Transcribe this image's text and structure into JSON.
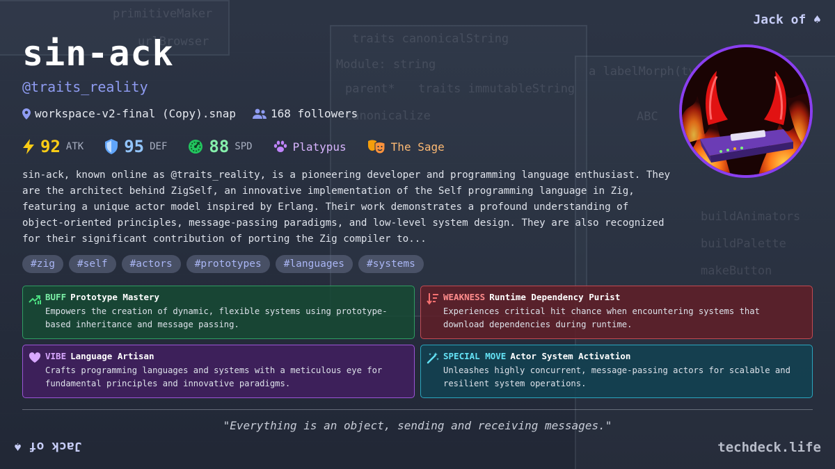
{
  "card": {
    "corner_top": "Jack of ♠",
    "corner_bottom": "Jack of ♠",
    "name": "sin-ack",
    "handle": "@traits_reality",
    "location": "workspace-v2-final (Copy).snap",
    "followers": "168 followers",
    "stats": {
      "atk_value": "92",
      "atk_label": "ATK",
      "def_value": "95",
      "def_label": "DEF",
      "spd_value": "88",
      "spd_label": "SPD",
      "animal": "Platypus",
      "archetype": "The Sage"
    },
    "bio": "sin-ack, known online as @traits_reality, is a pioneering developer and programming language enthusiast. They are the architect behind ZigSelf, an innovative implementation of the Self programming language in Zig, featuring a unique actor model inspired by Erlang. Their work demonstrates a profound understanding of object-oriented principles, message-passing paradigms, and low-level system design. They are also recognized for their significant contribution of porting the Zig compiler to...",
    "tags": [
      "#zig",
      "#self",
      "#actors",
      "#prototypes",
      "#languages",
      "#systems"
    ],
    "buff": {
      "kind": "BUFF",
      "title": "Prototype Mastery",
      "desc": "Empowers the creation of dynamic, flexible systems using prototype-based inheritance and message passing."
    },
    "weakness": {
      "kind": "WEAKNESS",
      "title": "Runtime Dependency Purist",
      "desc": "Experiences critical hit chance when encountering systems that download dependencies during runtime."
    },
    "vibe": {
      "kind": "VIBE",
      "title": "Language Artisan",
      "desc": "Crafts programming languages and systems with a meticulous eye for fundamental principles and innovative paradigms."
    },
    "special": {
      "kind": "SPECIAL MOVE",
      "title": "Actor System Activation",
      "desc": "Unleashes highly concurrent, message-passing actors for scalable and resilient system operations."
    },
    "quote": "\"Everything is an object, sending and receiving messages.\"",
    "site": "techdeck.life"
  },
  "background_text": {
    "primitive_maker": "primitiveMaker",
    "url_browser": "urlBrowser",
    "traits_title": "traits canonicalString",
    "module": "Module: string",
    "parent": "parent*",
    "immutable": "traits immutableString",
    "canonicalize": "canonicalize",
    "label_morph": "a labelMorph(type: ABC)",
    "abc": "ABC",
    "build_animators": "buildAnimators",
    "build_palette": "buildPalette",
    "make_button": "makeButton"
  },
  "icons": {
    "location": "map-pin-icon",
    "followers": "users-icon",
    "atk": "lightning-icon",
    "def": "shield-icon",
    "spd": "gauge-icon",
    "animal": "paw-icon",
    "archetype": "theater-masks-icon",
    "buff": "trend-up-icon",
    "weakness": "sort-down-icon",
    "vibe": "heart-icon",
    "special": "magic-wand-icon"
  },
  "colors": {
    "accent": "#8f9cf2",
    "atk": "#facc15",
    "def": "#93c5fd",
    "spd": "#86efac",
    "animal": "#d8b4fe",
    "archetype": "#fdba74",
    "avatar_ring": "#8a3ff0"
  }
}
